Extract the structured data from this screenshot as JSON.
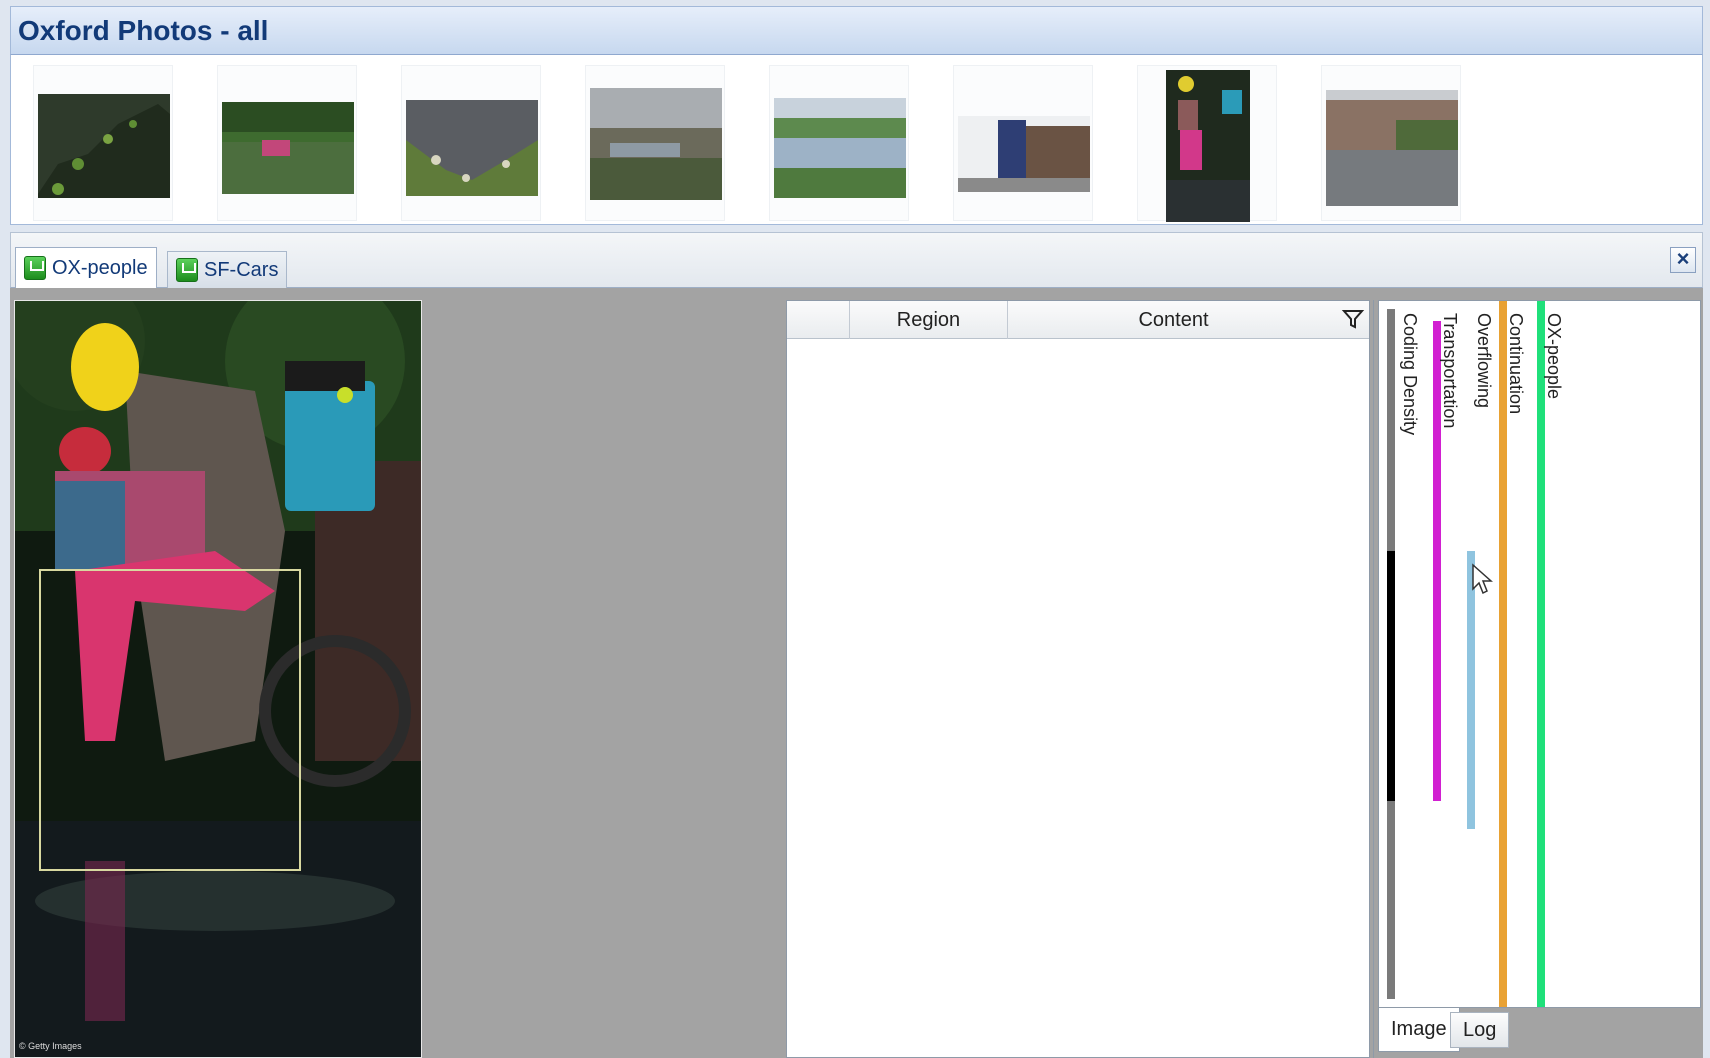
{
  "app": {
    "title": "Oxford Photos - all"
  },
  "thumbnails": [
    {
      "name": "thumb-1",
      "colors": [
        "#2e4128",
        "#4d7a2e",
        "#1b2415"
      ]
    },
    {
      "name": "thumb-2",
      "colors": [
        "#4a7a3a",
        "#2d5128",
        "#b33b6e"
      ]
    },
    {
      "name": "thumb-3",
      "colors": [
        "#5c5f63",
        "#6b7e3d",
        "#3b5024"
      ]
    },
    {
      "name": "thumb-4",
      "colors": [
        "#b0b4b8",
        "#6b6a5c",
        "#4a5a3a"
      ]
    },
    {
      "name": "thumb-5",
      "colors": [
        "#c9d3dd",
        "#5d8a4e",
        "#8aa0b8"
      ]
    },
    {
      "name": "thumb-6",
      "colors": [
        "#f1f2f3",
        "#2e3e74",
        "#6a5344"
      ]
    },
    {
      "name": "thumb-7",
      "colors": [
        "#1f2a1e",
        "#c94a92",
        "#d8c43b"
      ]
    },
    {
      "name": "thumb-8",
      "colors": [
        "#8a7264",
        "#4f6a3a",
        "#787b80"
      ]
    }
  ],
  "tabs": [
    {
      "label": "OX-people",
      "active": true
    },
    {
      "label": "SF-Cars",
      "active": false
    }
  ],
  "grid": {
    "columns": [
      "",
      "Region",
      "Content"
    ]
  },
  "viewer": {
    "watermark": "© Getty Images"
  },
  "stripes": [
    {
      "label": "Coding Density",
      "color": "#000000"
    },
    {
      "label": "Transportation",
      "color": "#d11fd1"
    },
    {
      "label": "Overflowing",
      "color": "#8fc4df"
    },
    {
      "label": "Continuation",
      "color": "#e9a234"
    },
    {
      "label": "OX-people",
      "color": "#1fe07a"
    }
  ],
  "bottom_tabs": [
    "Image",
    "Log"
  ],
  "icons": {
    "tab": "node-icon",
    "close": "close-icon",
    "filter": "filter-icon",
    "cursor": "mouse-cursor-icon"
  }
}
